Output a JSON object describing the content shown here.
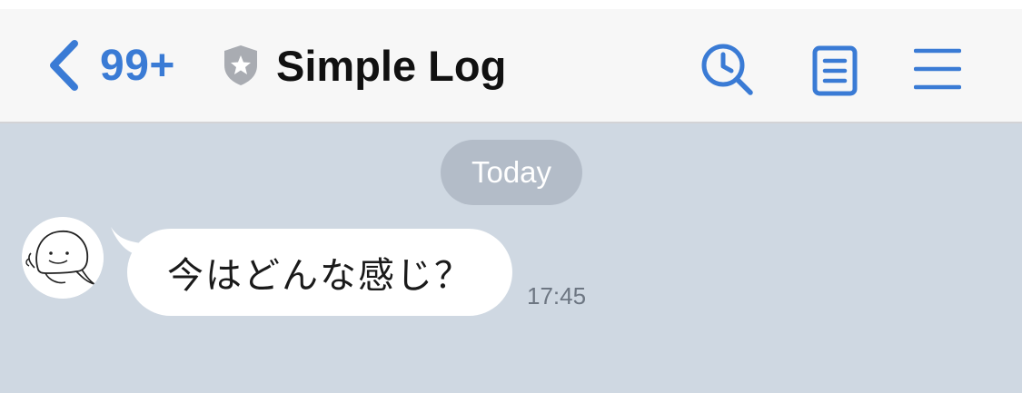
{
  "header": {
    "unread_count": "99+",
    "title": "Simple Log",
    "verified_badge_icon": "shield-star-icon"
  },
  "actions": {
    "back_icon": "chevron-left-icon",
    "search_icon": "search-clock-icon",
    "notes_icon": "document-icon",
    "menu_icon": "hamburger-menu-icon"
  },
  "chat": {
    "date_separator": "Today",
    "messages": [
      {
        "sender_avatar": "beluga-avatar",
        "text": "今はどんな感じ？",
        "time": "17:45"
      }
    ]
  },
  "colors": {
    "accent": "#3a7bd5",
    "nav_background": "#f7f7f7",
    "chat_background": "#cfd8e2",
    "date_pill": "#b3bcc8",
    "bubble": "#ffffff"
  }
}
